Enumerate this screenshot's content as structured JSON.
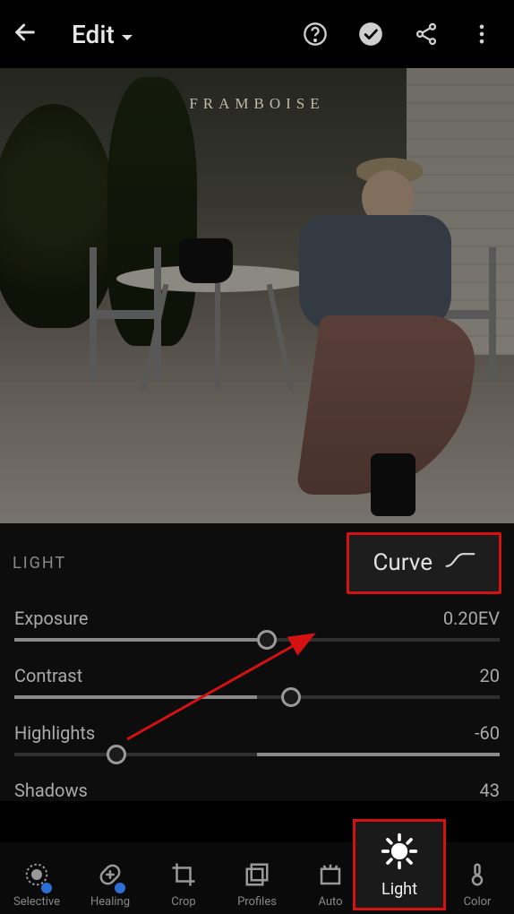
{
  "header": {
    "title": "Edit"
  },
  "image": {
    "overlay_text": "FRAMBOISE"
  },
  "panel": {
    "title": "LIGHT",
    "curve_label": "Curve",
    "sliders": {
      "exposure": {
        "label": "Exposure",
        "value_text": "0.20EV",
        "percent": 52
      },
      "contrast": {
        "label": "Contrast",
        "value_text": "20",
        "percent": 57
      },
      "highlights": {
        "label": "Highlights",
        "value_text": "-60",
        "percent": 21
      },
      "shadows": {
        "label": "Shadows",
        "value_text": "43"
      }
    }
  },
  "tools": {
    "selective": "Selective",
    "healing": "Healing",
    "crop": "Crop",
    "profiles": "Profiles",
    "auto": "Auto",
    "light": "Light",
    "color": "Color"
  },
  "annotation": {
    "curve_highlight": "#d41212",
    "light_highlight": "#d41212"
  }
}
